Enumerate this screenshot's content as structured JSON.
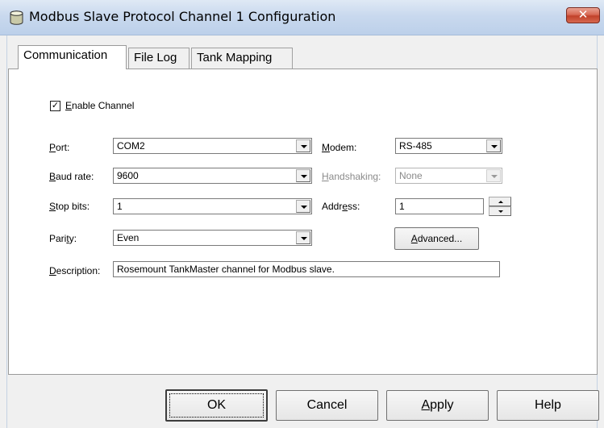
{
  "window": {
    "title": "Modbus Slave Protocol Channel 1 Configuration",
    "close_label": "✕"
  },
  "tabs": [
    {
      "label": "Communication",
      "active": true
    },
    {
      "label": "File Log",
      "active": false
    },
    {
      "label": "Tank Mapping",
      "active": false
    }
  ],
  "communication": {
    "enable_channel": {
      "label_prefix": "",
      "mnemonic": "E",
      "label_rest": "nable Channel",
      "checked": true,
      "check_glyph": "✓"
    },
    "port": {
      "mnemonic": "P",
      "label_rest": "ort:",
      "value": "COM2"
    },
    "baud_rate": {
      "mnemonic": "B",
      "label_rest": "aud rate:",
      "value": "9600"
    },
    "stop_bits": {
      "mnemonic": "S",
      "label_rest": "top bits:",
      "value": "1"
    },
    "parity": {
      "label_prefix": "Pari",
      "mnemonic": "t",
      "label_rest": "y:",
      "value": "Even"
    },
    "modem": {
      "mnemonic": "M",
      "label_rest": "odem:",
      "value": "RS-485"
    },
    "handshaking": {
      "mnemonic": "H",
      "label_rest": "andshaking:",
      "value": "None",
      "enabled": false
    },
    "address": {
      "label_prefix": "Addr",
      "mnemonic": "e",
      "label_rest": "ss:",
      "value": "1"
    },
    "advanced_button": {
      "mnemonic": "A",
      "label_rest": "dvanced..."
    },
    "description": {
      "mnemonic": "D",
      "label_rest": "escription:",
      "value": "Rosemount TankMaster channel for Modbus slave."
    }
  },
  "buttons": {
    "ok": "OK",
    "cancel": "Cancel",
    "apply_mnemonic": "A",
    "apply_rest": "pply",
    "help": "Help"
  },
  "colors": {
    "titlebar": "#c9d9ee",
    "close_button": "#c1412a",
    "dialog_face": "#f0f0f0",
    "panel": "#ffffff"
  }
}
